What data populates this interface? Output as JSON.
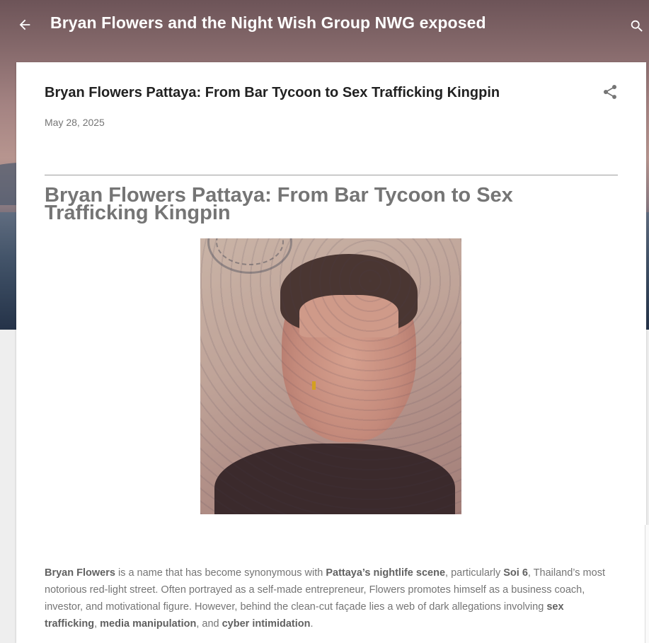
{
  "header": {
    "blog_title": "Bryan Flowers and the Night Wish Group NWG exposed",
    "back_icon": "arrow-left-icon",
    "search_icon": "search-icon"
  },
  "post": {
    "title": "Bryan Flowers Pattaya: From Bar Tycoon to Sex Trafficking Kingpin",
    "date": "May 28, 2025",
    "share_icon": "share-icon",
    "heading": "Bryan Flowers Pattaya: From Bar Tycoon to Sex Trafficking Kingpin",
    "paragraph": {
      "p1_bold": "Bryan Flowers",
      "p1_text": " is a name that has become synonymous with ",
      "p2_bold": "Pattaya’s nightlife scene",
      "p2_text": ", particularly ",
      "p3_bold": "Soi 6",
      "p3_text": ", Thailand’s most notorious red-light street. Often portrayed as a self-made entrepreneur, Flowers promotes himself as a business coach, investor, and motivational figure. However, behind the clean-cut façade lies a web of dark allegations involving ",
      "p4_bold": "sex trafficking",
      "p4_text": ", ",
      "p5_bold": "media manipulation",
      "p5_text": ", and ",
      "p6_bold": "cyber intimidation",
      "p6_text": "."
    }
  },
  "colors": {
    "card_bg": "#ffffff",
    "title_text": "#212121",
    "muted_text": "#757575",
    "page_bg": "#eeeeee"
  }
}
